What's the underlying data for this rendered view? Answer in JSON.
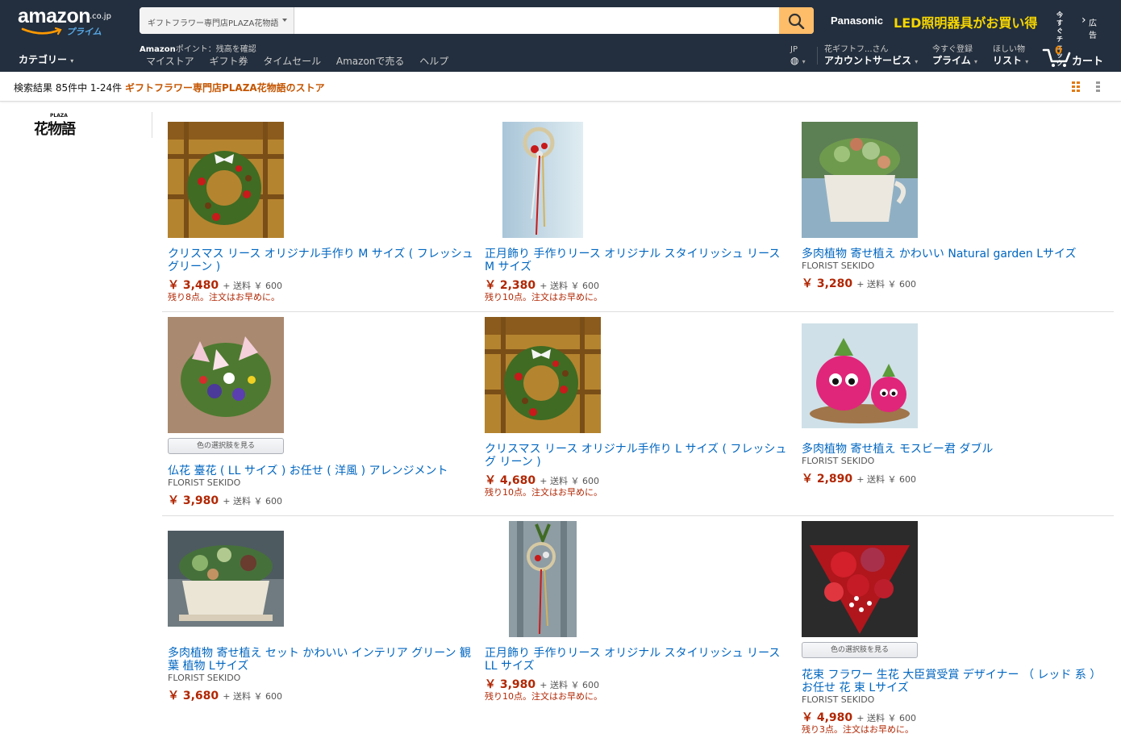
{
  "header": {
    "logo_text": "amazon",
    "logo_domain": ".co.jp",
    "logo_prime": "プライム",
    "search_scope": "ギフトフラワー専門店PLAZA花物語",
    "search_value": "",
    "ad_brand": "Panasonic",
    "ad_text": "LED照明器具がお買い得",
    "ad_now": "今すぐ",
    "ad_check": "チェック",
    "ad_label": "広告",
    "category_label": "カテゴリー",
    "points_bold": "Amazon",
    "points_rest": "ポイント：残高を確認",
    "nav_links": [
      "マイストア",
      "ギフト券",
      "タイムセール",
      "Amazonで売る",
      "ヘルプ"
    ],
    "lang_top": "JP",
    "account_top": "花ギフトフ...さん",
    "account_bottom": "アカウントサービス",
    "prime_top": "今すぐ登録",
    "prime_bottom": "プライム",
    "list_top": "ほしい物",
    "list_bottom": "リスト",
    "cart_count": "0",
    "cart_label": "カート"
  },
  "results": {
    "count_text": "検索結果 85件中 1-24件",
    "store_name": "ギフトフラワー専門店PLAZA花物語のストア"
  },
  "store_logo": {
    "small": "PLAZA",
    "big": "花物語"
  },
  "color_button_label": "色の選択肢を見る",
  "shipping_prefix": "+ 送料 ￥ 600",
  "products": [
    {
      "title": "クリスマス リース オリジナル手作り M サイズ ( フレッシュ グリーン )",
      "brand": "",
      "price": "￥ 3,480",
      "stock": "残り8点。注文はお早めに。",
      "image": "wreath"
    },
    {
      "title": "正月飾り 手作りリース オリジナル スタイリッシュ リース M サイズ",
      "brand": "",
      "price": "￥ 2,380",
      "stock": "残り10点。注文はお早めに。",
      "image": "newyear"
    },
    {
      "title": "多肉植物 寄せ植え かわいい Natural garden Lサイズ",
      "brand": "FLORIST SEKIDO",
      "price": "￥ 3,280",
      "stock": "",
      "image": "succulent-pot"
    },
    {
      "title": "仏花 臺花 ( LL サイズ ) お任せ ( 洋風 ) アレンジメント",
      "brand": "FLORIST SEKIDO",
      "price": "￥ 3,980",
      "stock": "",
      "image": "lily"
    },
    {
      "title": "クリスマス リース オリジナル手作り L サイズ ( フレッシュグ リーン )",
      "brand": "",
      "price": "￥ 4,680",
      "stock": "残り10点。注文はお早めに。",
      "image": "wreath"
    },
    {
      "title": "多肉植物 寄せ植え モスビー君 ダブル",
      "brand": "FLORIST SEKIDO",
      "price": "￥ 2,890",
      "stock": "",
      "image": "mossby"
    },
    {
      "title": "多肉植物 寄せ植え セット かわいい インテリア グリーン 観葉 植物 Lサイズ",
      "brand": "FLORIST SEKIDO",
      "price": "￥ 3,680",
      "stock": "",
      "image": "succulent-tray"
    },
    {
      "title": "正月飾り 手作りリース オリジナル スタイリッシュ リース LL サイズ",
      "brand": "",
      "price": "￥ 3,980",
      "stock": "残り10点。注文はお早めに。",
      "image": "newyear-ll"
    },
    {
      "title": "花束 フラワー 生花 大臣賞受賞 デザイナー （ レッド 系 ） お任せ 花 束 Lサイズ",
      "brand": "FLORIST SEKIDO",
      "price": "￥ 4,980",
      "stock": "残り3点。注文はお早めに。",
      "image": "bouquet"
    }
  ]
}
